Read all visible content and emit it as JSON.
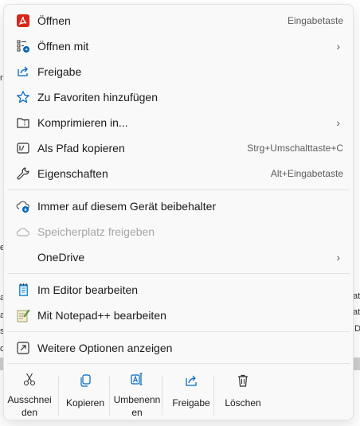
{
  "background": {
    "fragments": [
      "n",
      "e",
      "a",
      "a",
      "o",
      "s",
      "at",
      "at",
      "D"
    ]
  },
  "menu": {
    "items": [
      {
        "label": "Öffnen",
        "icon": "pdf-icon",
        "shortcut": "Eingabetaste"
      },
      {
        "label": "Öffnen mit",
        "icon": "open-with-icon",
        "submenu": true
      },
      {
        "label": "Freigabe",
        "icon": "share-icon"
      },
      {
        "label": "Zu Favoriten hinzufügen",
        "icon": "star-icon"
      },
      {
        "label": "Komprimieren in...",
        "icon": "zip-folder-icon",
        "submenu": true
      },
      {
        "label": "Als Pfad kopieren",
        "icon": "copy-path-icon",
        "shortcut": "Strg+Umschalttaste+C"
      },
      {
        "label": "Eigenschaften",
        "icon": "wrench-icon",
        "shortcut": "Alt+Eingabetaste"
      },
      {
        "label": "Immer auf diesem Gerät beibehalter",
        "icon": "cloud-download-icon"
      },
      {
        "label": "Speicherplatz freigeben",
        "icon": "cloud-icon",
        "disabled": true
      },
      {
        "label": "OneDrive",
        "submenu": true
      },
      {
        "label": "Im Editor bearbeiten",
        "icon": "notepad-icon"
      },
      {
        "label": "Mit Notepad++ bearbeiten",
        "icon": "notepadpp-icon"
      },
      {
        "label": "Weitere Optionen anzeigen",
        "icon": "more-options-icon"
      }
    ],
    "chevron": "›",
    "actions": [
      {
        "label": "Ausschneiden",
        "icon": "scissors-icon"
      },
      {
        "label": "Kopieren",
        "icon": "copy-icon"
      },
      {
        "label": "Umbenennen",
        "icon": "rename-icon"
      },
      {
        "label": "Freigabe",
        "icon": "share-icon"
      },
      {
        "label": "Löschen",
        "icon": "trash-icon"
      }
    ]
  },
  "colors": {
    "accent": "#0067c0",
    "pdf_red": "#d9261c"
  }
}
